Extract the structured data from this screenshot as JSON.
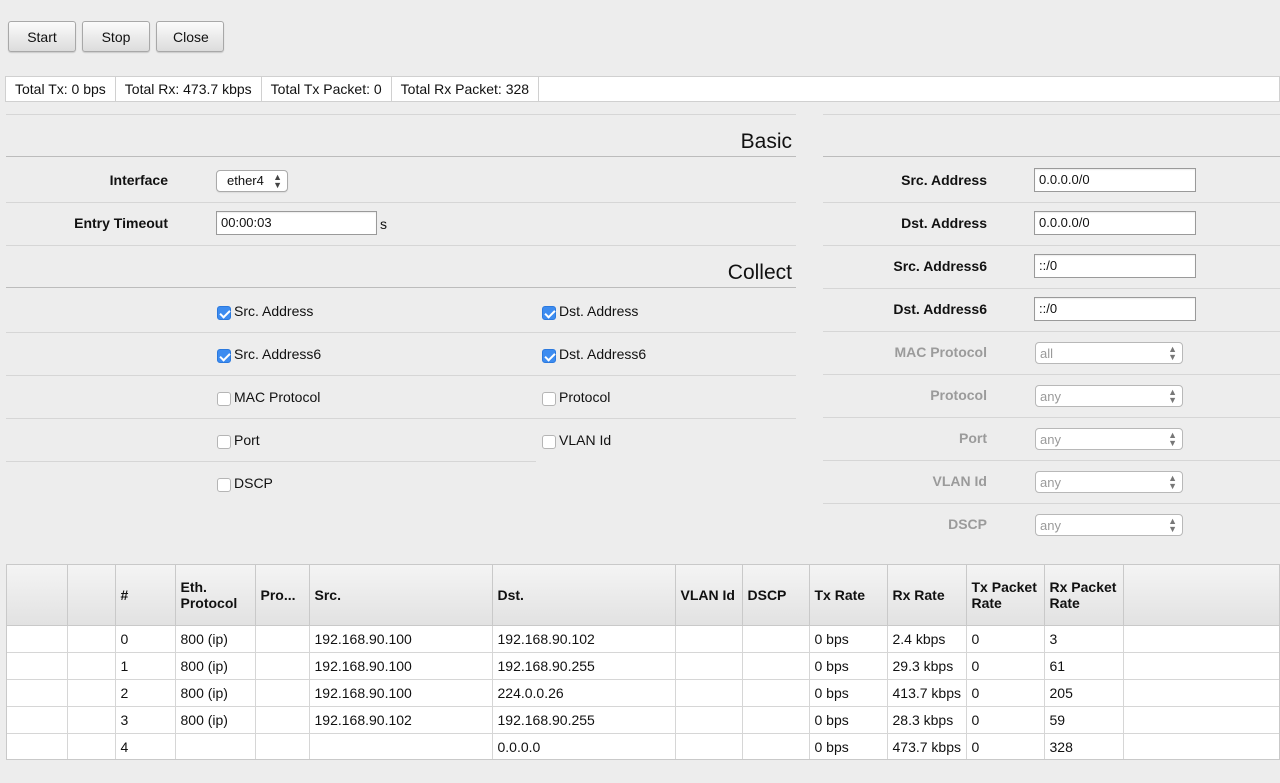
{
  "toolbar": {
    "start": "Start",
    "stop": "Stop",
    "close": "Close"
  },
  "status": {
    "tx": "Total Tx: 0 bps",
    "rx": "Total Rx: 473.7 kbps",
    "tx_packet": "Total Tx Packet: 0",
    "rx_packet": "Total Rx Packet: 328"
  },
  "basic": {
    "title": "Basic",
    "interface_label": "Interface",
    "interface_value": "ether4",
    "timeout_label": "Entry Timeout",
    "timeout_value": "00:00:03",
    "timeout_unit": "s"
  },
  "collect": {
    "title": "Collect",
    "items": [
      {
        "label": "Src. Address",
        "checked": true
      },
      {
        "label": "Dst. Address",
        "checked": true
      },
      {
        "label": "Src. Address6",
        "checked": true
      },
      {
        "label": "Dst. Address6",
        "checked": true
      },
      {
        "label": "MAC Protocol",
        "checked": false
      },
      {
        "label": "Protocol",
        "checked": false
      },
      {
        "label": "Port",
        "checked": false
      },
      {
        "label": "VLAN Id",
        "checked": false
      },
      {
        "label": "DSCP",
        "checked": false
      }
    ]
  },
  "filters": {
    "src_address": {
      "label": "Src. Address",
      "value": "0.0.0.0/0"
    },
    "dst_address": {
      "label": "Dst. Address",
      "value": "0.0.0.0/0"
    },
    "src_address6": {
      "label": "Src. Address6",
      "value": "::/0"
    },
    "dst_address6": {
      "label": "Dst. Address6",
      "value": "::/0"
    },
    "mac_protocol": {
      "label": "MAC Protocol",
      "value": "all"
    },
    "protocol": {
      "label": "Protocol",
      "value": "any"
    },
    "port": {
      "label": "Port",
      "value": "any"
    },
    "vlan_id": {
      "label": "VLAN Id",
      "value": "any"
    },
    "dscp": {
      "label": "DSCP",
      "value": "any"
    }
  },
  "table": {
    "headers": [
      "",
      "",
      "#",
      "Eth. Protocol",
      "Pro...",
      "Src.",
      "Dst.",
      "VLAN Id",
      "DSCP",
      "Tx Rate",
      "Rx Rate",
      "Tx Packet Rate",
      "Rx Packet Rate",
      ""
    ],
    "rows": [
      [
        "",
        "",
        "0",
        "800 (ip)",
        "",
        "192.168.90.100",
        "192.168.90.102",
        "",
        "",
        "0 bps",
        "2.4 kbps",
        "0",
        "3",
        ""
      ],
      [
        "",
        "",
        "1",
        "800 (ip)",
        "",
        "192.168.90.100",
        "192.168.90.255",
        "",
        "",
        "0 bps",
        "29.3 kbps",
        "0",
        "61",
        ""
      ],
      [
        "",
        "",
        "2",
        "800 (ip)",
        "",
        "192.168.90.100",
        "224.0.0.26",
        "",
        "",
        "0 bps",
        "413.7 kbps",
        "0",
        "205",
        ""
      ],
      [
        "",
        "",
        "3",
        "800 (ip)",
        "",
        "192.168.90.102",
        "192.168.90.255",
        "",
        "",
        "0 bps",
        "28.3 kbps",
        "0",
        "59",
        ""
      ],
      [
        "",
        "",
        "4",
        "",
        "",
        "",
        "0.0.0.0",
        "",
        "",
        "0 bps",
        "473.7 kbps",
        "0",
        "328",
        ""
      ]
    ]
  }
}
